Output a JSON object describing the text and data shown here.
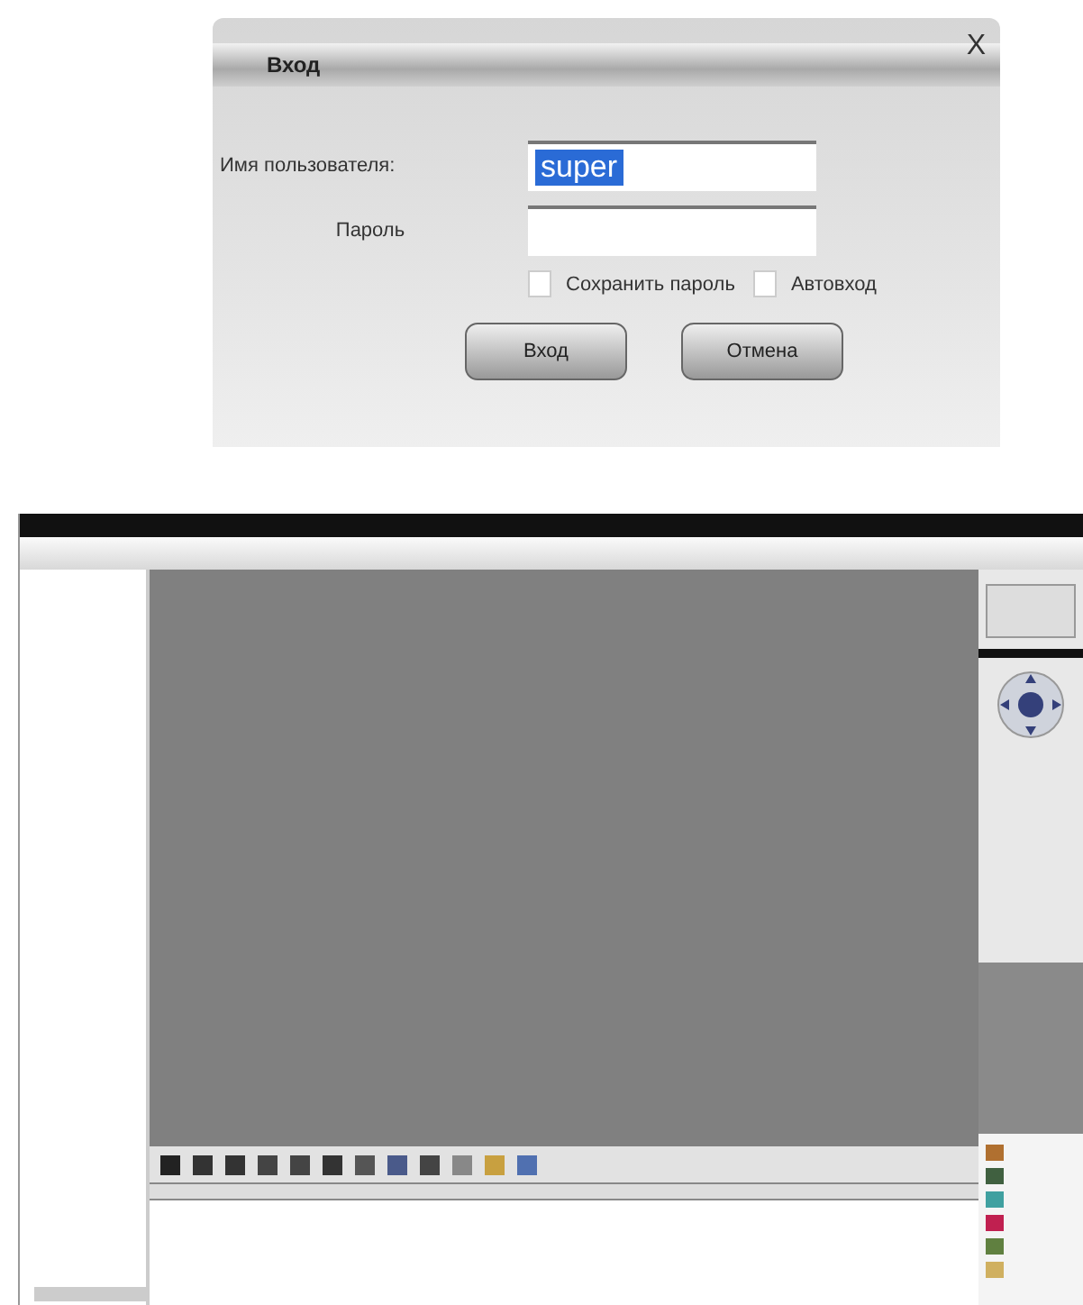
{
  "dialog": {
    "title": "Вход",
    "close": "X",
    "fields": [
      {
        "label": "Имя пользователя:",
        "value": "super",
        "highlighted": true
      },
      {
        "label": "Пароль"
      }
    ],
    "checkboxes": [
      {
        "label": "Сохранить пароль",
        "checked": false
      },
      {
        "label": "Автовход",
        "checked": false
      }
    ],
    "buttons": [
      "Вход",
      "Отмена"
    ]
  }
}
